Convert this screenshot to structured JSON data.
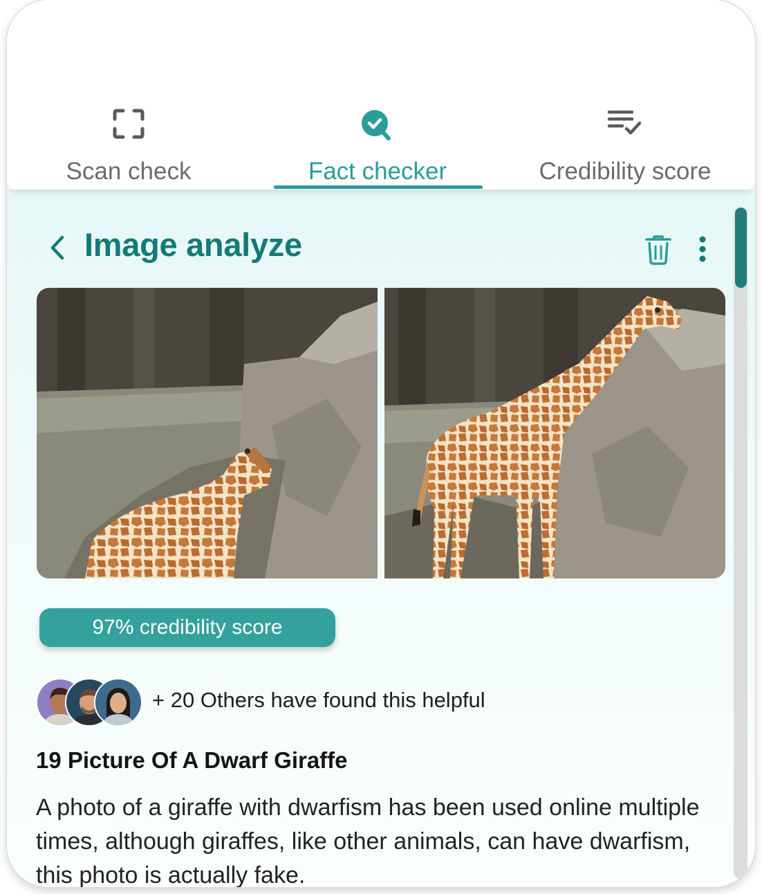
{
  "tabs": [
    {
      "label": "Scan check",
      "icon": "scan-icon",
      "active": false
    },
    {
      "label": "Fact checker",
      "icon": "fact-check-icon",
      "active": true
    },
    {
      "label": "Credibility score",
      "icon": "list-check-icon",
      "active": false
    }
  ],
  "header": {
    "title": "Image analyze",
    "back_icon": "chevron-left-icon",
    "trash_icon": "trash-icon",
    "more_icon": "more-vertical-icon"
  },
  "images": [
    {
      "description_icon": "giraffe-photo-dwarf"
    },
    {
      "description_icon": "giraffe-photo-original"
    }
  ],
  "credibility": {
    "label": "97% credibility score",
    "percent": 97
  },
  "social": {
    "helpful_text": "+ 20 Others have found this helpful",
    "avatar_count": 3
  },
  "article": {
    "title": "19 Picture Of A Dwarf Giraffe",
    "body": "A photo of a giraffe with dwarfism has been used online multiple times, although giraffes, like other animals, can have dwarfism, this photo is actually fake."
  },
  "colors": {
    "accent": "#2a9c9a",
    "title": "#137a76",
    "pill": "#35a19d",
    "scroll_thumb": "#227c78"
  }
}
